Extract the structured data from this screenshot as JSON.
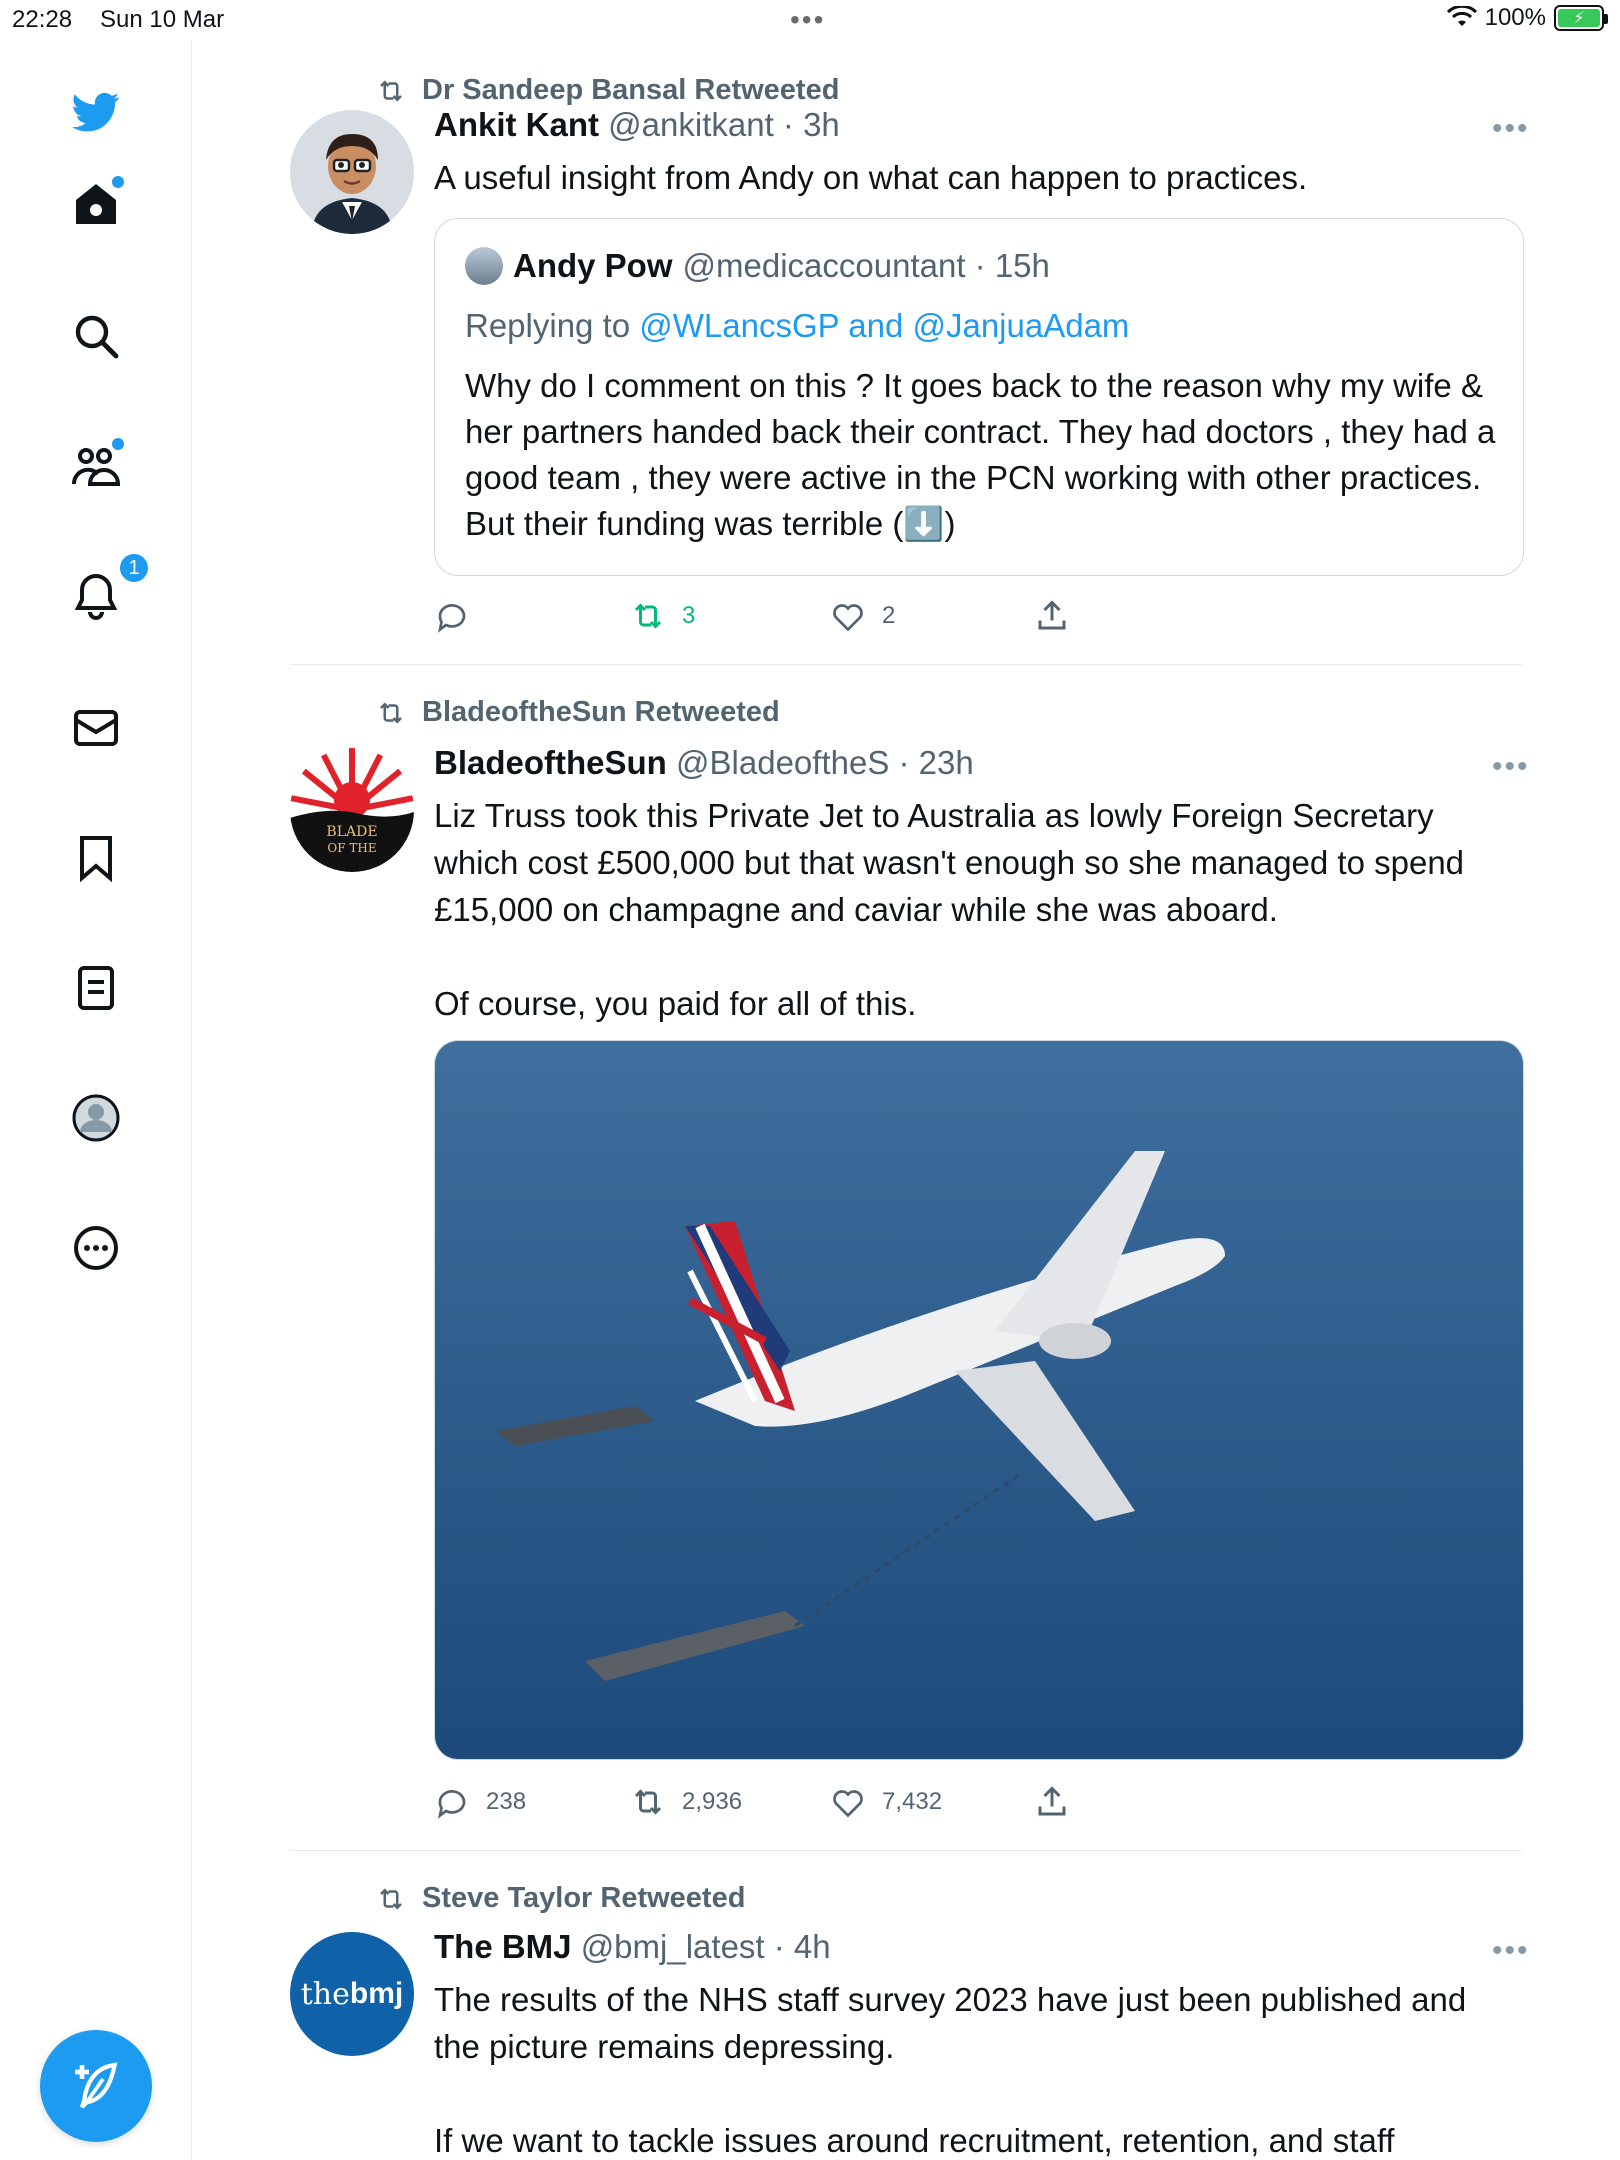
{
  "status_bar": {
    "time": "22:28",
    "date": "Sun 10 Mar",
    "battery": "100%"
  },
  "sidebar": {
    "items": [
      {
        "name": "home"
      },
      {
        "name": "search"
      },
      {
        "name": "communities"
      },
      {
        "name": "notifications",
        "badge": "1"
      },
      {
        "name": "messages"
      },
      {
        "name": "bookmarks"
      },
      {
        "name": "lists"
      },
      {
        "name": "profile"
      },
      {
        "name": "more"
      }
    ],
    "compose_icon": "feather-plus-icon"
  },
  "tweets": [
    {
      "retweeted_by": "Dr Sandeep Bansal Retweeted",
      "name": "Ankit Kant",
      "meta": "@ankitkant · 3h",
      "text": "A useful insight from Andy on what can happen to practices.",
      "quote": {
        "name": "Andy Pow",
        "meta": "@medicaccountant · 15h",
        "replying_prefix": "Replying to",
        "replying_mentions": "@WLancsGP and @JanjuaAdam",
        "text": "Why do I comment on this ? It goes back to the reason why my wife & her partners handed back their contract. They had doctors , they had a good team , they were active in the PCN working with other practices. But their funding was terrible (⬇️)"
      },
      "actions": {
        "replies": "",
        "retweets": "3",
        "likes": "2"
      }
    },
    {
      "retweeted_by": "BladeoftheSun Retweeted",
      "name": "BladeoftheSun",
      "meta": "@BladeoftheS · 23h",
      "text": "Liz Truss took this Private Jet to Australia as lowly Foreign Secretary which cost £500,000 but that wasn't enough so she managed to spend £15,000 on champagne and caviar while she was aboard.\n\nOf course, you paid for all of this.",
      "avatar_text": "BLADE OF THE",
      "actions": {
        "replies": "238",
        "retweets": "2,936",
        "likes": "7,432"
      }
    },
    {
      "retweeted_by": "Steve Taylor Retweeted",
      "name": "The BMJ",
      "meta": "@bmj_latest · 4h",
      "avatar_text_1": "the",
      "avatar_text_2": "bmj",
      "text": "The results of the NHS staff survey 2023 have just been published and the picture remains depressing.\n\nIf we want to tackle issues around recruitment, retention, and staff"
    }
  ],
  "colors": {
    "accent": "#1d9bf0",
    "retweet_active": "#00ba7c",
    "secondary_text": "#536471"
  }
}
